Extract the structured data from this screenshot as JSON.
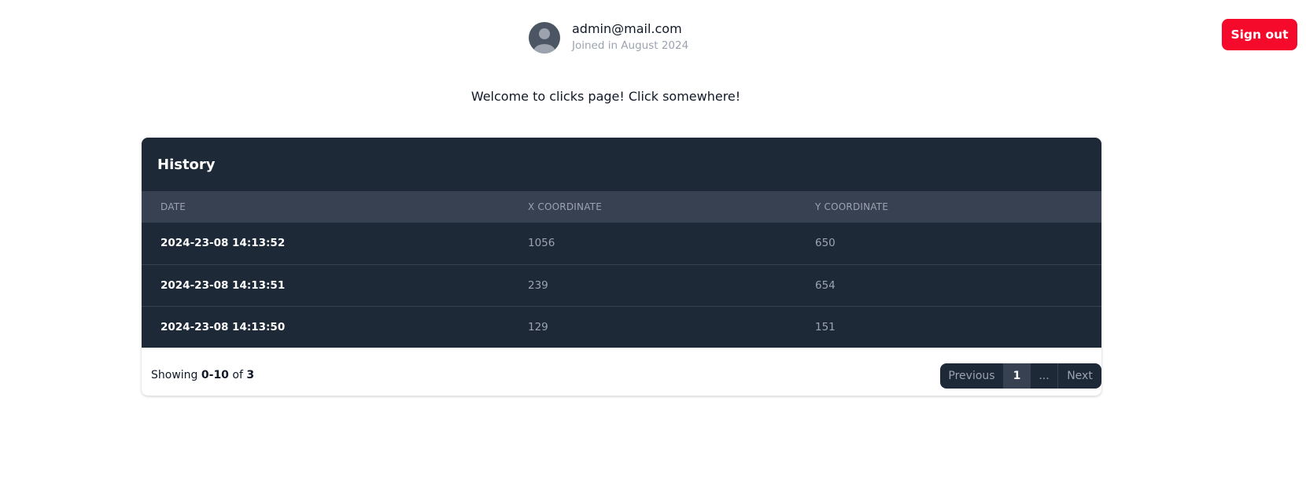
{
  "user": {
    "email": "admin@mail.com",
    "joined": "Joined in August 2024",
    "avatar_icon": "user-silhouette-icon"
  },
  "header": {
    "signout_label": "Sign out",
    "signout_color": "#f50a2c"
  },
  "welcome_text": "Welcome to clicks page! Click somewhere!",
  "history": {
    "title": "History",
    "columns": [
      "DATE",
      "X COORDINATE",
      "Y COORDINATE"
    ],
    "rows": [
      {
        "date": "2024-23-08 14:13:52",
        "x": "1056",
        "y": "650"
      },
      {
        "date": "2024-23-08 14:13:51",
        "x": "239",
        "y": "654"
      },
      {
        "date": "2024-23-08 14:13:50",
        "x": "129",
        "y": "151"
      }
    ]
  },
  "footer": {
    "showing_prefix": "Showing",
    "showing_range": "0-10",
    "showing_of": "of",
    "showing_total": "3"
  },
  "pagination": {
    "previous": "Previous",
    "current_page": "1",
    "ellipsis": "...",
    "next": "Next"
  },
  "colors": {
    "dark_panel": "#1e2938",
    "header_row": "#374151",
    "muted_text": "#9ca3af"
  }
}
